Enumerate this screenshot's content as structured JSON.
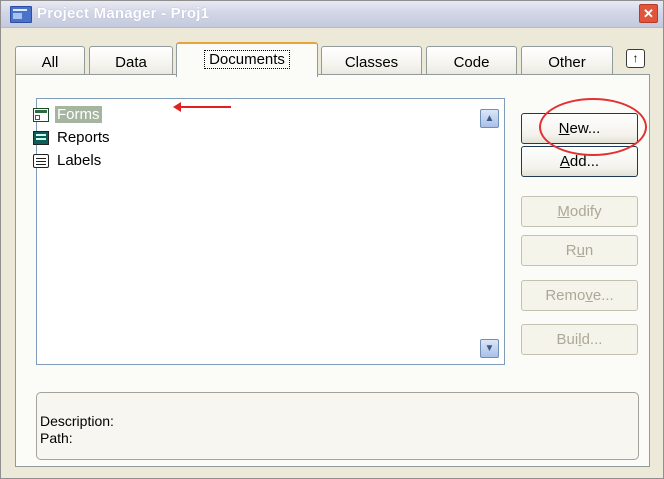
{
  "window": {
    "title": "Project Manager - Proj1",
    "close_glyph": "✕"
  },
  "tabs": [
    {
      "label": "All",
      "active": false
    },
    {
      "label": "Data",
      "active": false
    },
    {
      "label": "Documents",
      "active": true
    },
    {
      "label": "Classes",
      "active": false
    },
    {
      "label": "Code",
      "active": false
    },
    {
      "label": "Other",
      "active": false
    }
  ],
  "tab_scroll_glyph": "↑",
  "document_tree": {
    "items": [
      {
        "label": "Forms",
        "icon": "forms-icon",
        "selected": true
      },
      {
        "label": "Reports",
        "icon": "reports-icon",
        "selected": false
      },
      {
        "label": "Labels",
        "icon": "labels-icon",
        "selected": false
      }
    ]
  },
  "scrollbar": {
    "up_glyph": "▲",
    "down_glyph": "▼"
  },
  "buttons": {
    "new": {
      "before": "",
      "mnemonic": "N",
      "after": "ew...",
      "enabled": true
    },
    "add": {
      "before": "",
      "mnemonic": "A",
      "after": "dd...",
      "enabled": true
    },
    "modify": {
      "before": "",
      "mnemonic": "M",
      "after": "odify",
      "enabled": false
    },
    "run": {
      "before": "R",
      "mnemonic": "u",
      "after": "n",
      "enabled": false
    },
    "remove": {
      "before": "Remo",
      "mnemonic": "v",
      "after": "e...",
      "enabled": false
    },
    "build": {
      "before": "Bui",
      "mnemonic": "l",
      "after": "d...",
      "enabled": false
    }
  },
  "details": {
    "description_label": "Description:",
    "path_label": "Path:"
  },
  "annotation_colors": {
    "arrow": "#e32020",
    "ellipse": "#e33030"
  },
  "colors": {
    "window_bg": "#ece9d8",
    "active_tab_accent": "#e8a33a",
    "selection_bg": "#a6b5a0"
  }
}
